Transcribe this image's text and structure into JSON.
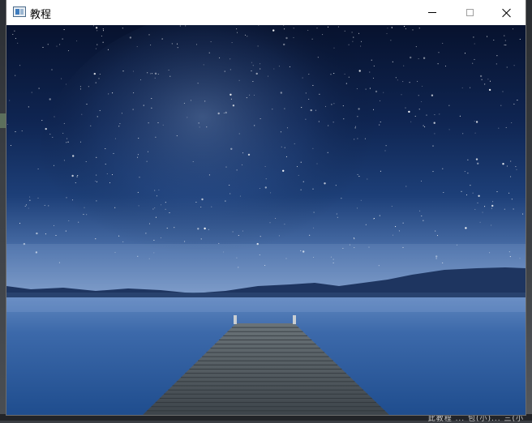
{
  "window": {
    "title": "教程"
  },
  "controls": {
    "minimize": "minimize",
    "maximize": "maximize",
    "close": "close"
  },
  "image": {
    "subject": "starry night sky over lake with wooden pier",
    "colors": {
      "sky_top": "#07122e",
      "sky_mid": "#1d3f78",
      "horizon": "#6f8fc0",
      "water": "#2d5fa3",
      "pier": "#4a5258"
    }
  },
  "background": {
    "bottom_text": "此教程 ... 包(小)... 三(小"
  }
}
